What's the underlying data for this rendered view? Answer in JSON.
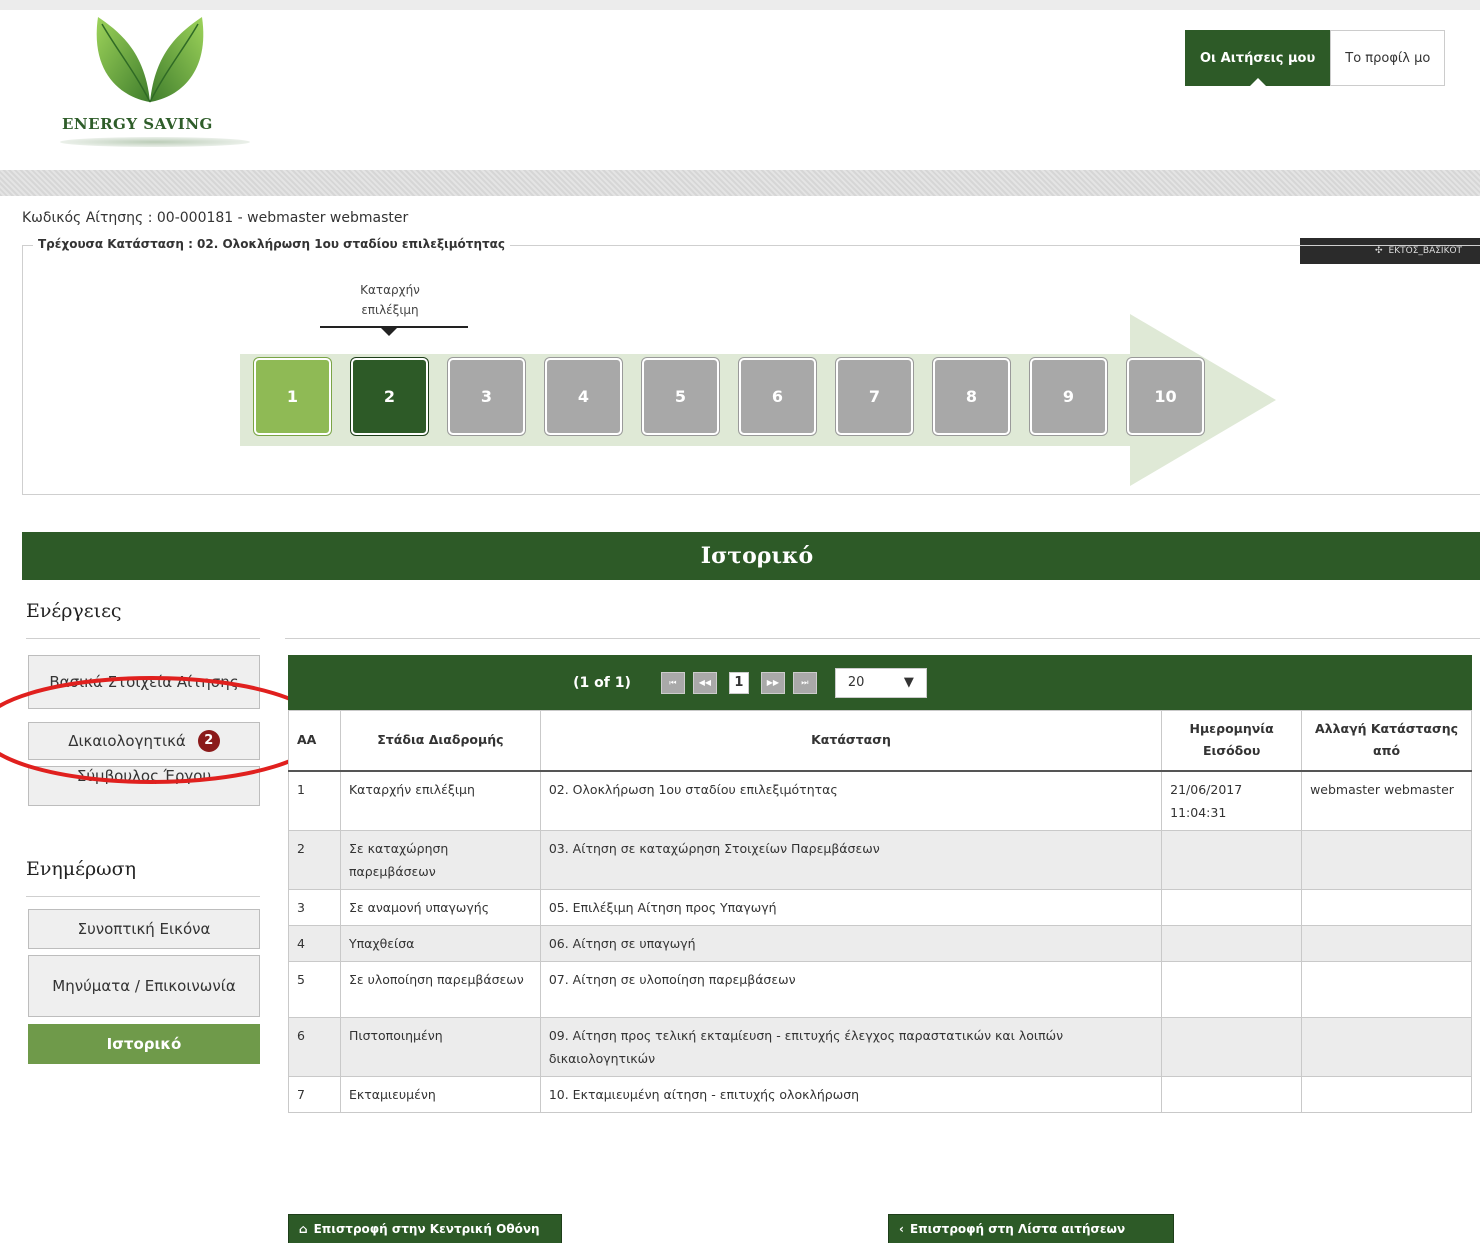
{
  "brand": {
    "name": "ENERGY SAVING"
  },
  "topnav": {
    "tabs": [
      {
        "label": "Οι Αιτήσεις μου",
        "active": true
      },
      {
        "label": "Το προφίλ μο",
        "active": false
      }
    ]
  },
  "application": {
    "code_line": "Κωδικός Αίτησης : 00-000181 - webmaster webmaster",
    "current_status": "Τρέχουσα Κατάσταση : 02. Ολοκλήρωση 1ου σταδίου επιλεξιμότητας",
    "dark_button_label": "ΕΚΤΟΣ_ΒΑΣΙΚΟΤ"
  },
  "stages": {
    "caption": "Καταρχήν επιλέξιμη",
    "steps": [
      "1",
      "2",
      "3",
      "4",
      "5",
      "6",
      "7",
      "8",
      "9",
      "10"
    ],
    "completed": 1,
    "current": 2
  },
  "section_title": "Ιστορικό",
  "sidebar": {
    "actions_heading": "Ενέργειες",
    "actions": [
      {
        "label": "Βασικά Στοιχεία Αίτησης"
      },
      {
        "label": "Δικαιολογητικά",
        "badge": "2"
      },
      {
        "label": "Σύμβουλος Έργου"
      }
    ],
    "info_heading": "Ενημέρωση",
    "info": [
      {
        "label": "Συνοπτική Εικόνα"
      },
      {
        "label": "Μηνύματα / Επικοινωνία"
      },
      {
        "label": "Ιστορικό",
        "active": true
      }
    ]
  },
  "pager": {
    "count": "(1 of 1)",
    "first": "⏮",
    "prev": "◀◀",
    "page": "1",
    "next": "▶▶",
    "last": "⏭",
    "page_size": "20"
  },
  "table": {
    "headers": [
      "ΑΑ",
      "Στάδια Διαδρομής",
      "Κατάσταση",
      "Ημερομηνία Εισόδου",
      "Αλλαγή Κατάστασης από"
    ],
    "rows": [
      {
        "aa": "1",
        "stage": "Καταρχήν επιλέξιμη",
        "status": "02. Ολοκλήρωση 1ου σταδίου επιλεξιμότητας",
        "date": "21/06/2017 11:04:31",
        "by": "webmaster webmaster"
      },
      {
        "aa": "2",
        "stage": "Σε καταχώρηση παρεμβάσεων",
        "status": "03. Αίτηση σε καταχώρηση Στοιχείων Παρεμβάσεων",
        "date": "",
        "by": ""
      },
      {
        "aa": "3",
        "stage": "Σε αναμονή υπαγωγής",
        "status": "05. Επιλέξιμη Αίτηση προς Υπαγωγή",
        "date": "",
        "by": ""
      },
      {
        "aa": "4",
        "stage": "Υπαχθείσα",
        "status": "06. Αίτηση σε υπαγωγή",
        "date": "",
        "by": ""
      },
      {
        "aa": "5",
        "stage": "Σε υλοποίηση παρεμβάσεων",
        "status": "07. Αίτηση σε υλοποίηση παρεμβάσεων",
        "date": "",
        "by": ""
      },
      {
        "aa": "6",
        "stage": "Πιστοποιημένη",
        "status": "09. Αίτηση προς τελική εκταμίευση - επιτυχής έλεγχος παραστατικών και λοιπών δικαιολογητικών",
        "date": "",
        "by": ""
      },
      {
        "aa": "7",
        "stage": "Εκταμιευμένη",
        "status": "10. Εκταμιευμένη αίτηση - επιτυχής ολοκλήρωση",
        "date": "",
        "by": ""
      }
    ]
  },
  "footer": {
    "home_button": "Επιστροφή στην Κεντρική Οθόνη",
    "list_button": "Επιστροφή στη Λίστα αιτήσεων"
  },
  "colors": {
    "primary": "#2d5a27",
    "completed_step": "#8fba55",
    "pending_step": "#a8a8a8",
    "annotation": "#e0201e",
    "badge": "#8b1a1a"
  }
}
